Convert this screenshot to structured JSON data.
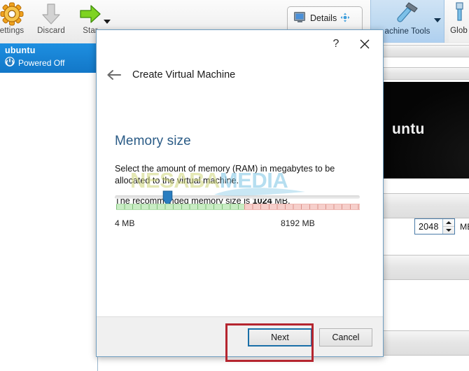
{
  "app": {
    "toolbar": {
      "buttons": [
        {
          "label": "ettings",
          "icon": "gear-icon"
        },
        {
          "label": "Discard",
          "icon": "down-arrow-icon"
        },
        {
          "label": "Star",
          "icon": "green-right-arrow-icon"
        }
      ],
      "details_tab": {
        "label": "Details",
        "icon": "monitor-icon",
        "badge_icon": "snapshot-icon"
      },
      "machine_tools": {
        "label": "achine Tools",
        "icon": "hammer-icon",
        "caret": "chevron-down-icon"
      },
      "global_tools": {
        "label": "Glob",
        "icon": "tools-icon"
      }
    },
    "vm_list": [
      {
        "name": "ubuntu",
        "state": "Powered Off",
        "icon": "power-icon"
      }
    ],
    "preview": {
      "label": "untu"
    }
  },
  "dialog": {
    "help_label": "?",
    "close_icon": "close-icon",
    "back_icon": "back-arrow-icon",
    "wizard_title": "Create Virtual Machine",
    "page_title": "Memory size",
    "paragraph_1": "Select the amount of memory (RAM) in megabytes to be allocated to the virtual machine.",
    "paragraph_2_prefix": "The recommended memory size is ",
    "paragraph_2_value": "1024",
    "paragraph_2_suffix": " MB.",
    "slider": {
      "min_label": "4 MB",
      "max_label": "8192 MB",
      "min_value": 4,
      "max_value": 8192,
      "current_value": 2048,
      "handle_position_pct": 19.5,
      "safe_zone_pct": 52.5,
      "warn_zone_pct": 47.5,
      "safe_color": "#c8ecc3",
      "warn_color": "#f6cfcb"
    },
    "spinbox": {
      "value": "2048",
      "unit": "MB",
      "up_icon": "spin-up-icon",
      "down_icon": "spin-down-icon"
    },
    "footer": {
      "next_label": "Next",
      "cancel_label": "Cancel",
      "focus_color": "#1a6fa8"
    }
  },
  "annotation": {
    "color": "#b5252f"
  },
  "watermark": {
    "part_a": "NESABA",
    "part_b": "MEDIA"
  }
}
